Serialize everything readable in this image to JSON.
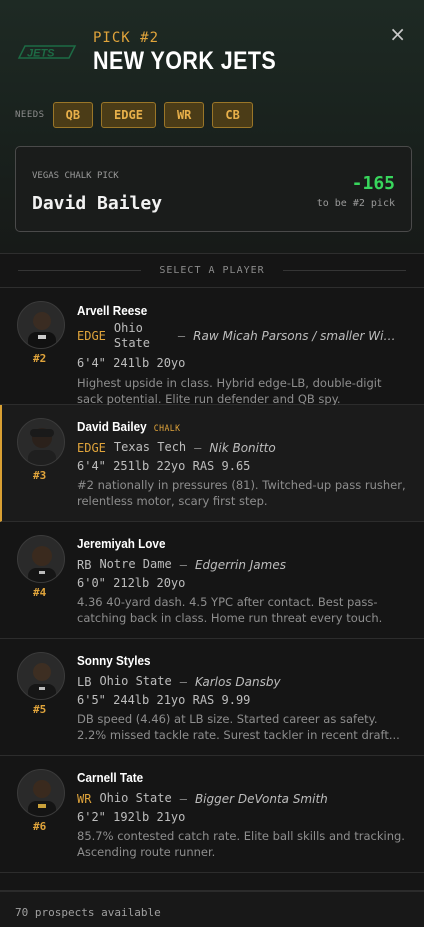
{
  "header": {
    "logo_text": "JETS",
    "pick_label": "PICK #2",
    "team_name": "NEW YORK JETS",
    "close_glyph": "×"
  },
  "needs": {
    "label": "NEEDS",
    "positions": [
      "QB",
      "EDGE",
      "WR",
      "CB"
    ]
  },
  "chalk": {
    "label": "VEGAS CHALK PICK",
    "player": "David Bailey",
    "odds": "-165",
    "sub": "to be #2 pick"
  },
  "select_label": "SELECT A PLAYER",
  "players": [
    {
      "name": "Arvell Reese",
      "tag": "",
      "position": "EDGE",
      "school": "Ohio State",
      "comp": "Raw Micah Parsons / smaller Willi...",
      "measures": "6'4\" 241lb 20yo",
      "blurb": "Highest upside in class. Hybrid edge-LB, double-digit sack potential. Elite run defender and QB spy.",
      "pick": "#2"
    },
    {
      "name": "David Bailey",
      "tag": "CHALK",
      "position": "EDGE",
      "school": "Texas Tech",
      "comp": "Nik Bonitto",
      "measures": "6'4\" 251lb 22yo RAS 9.65",
      "blurb": "#2 nationally in pressures (81). Twitched-up pass rusher, relentless motor, scary first step.",
      "pick": "#3"
    },
    {
      "name": "Jeremiyah Love",
      "tag": "",
      "position": "RB",
      "school": "Notre Dame",
      "comp": "Edgerrin James",
      "measures": "6'0\" 212lb 20yo",
      "blurb": "4.36 40-yard dash. 4.5 YPC after contact. Best pass-catching back in class. Home run threat every touch.",
      "pick": "#4"
    },
    {
      "name": "Sonny Styles",
      "tag": "",
      "position": "LB",
      "school": "Ohio State",
      "comp": "Karlos Dansby",
      "measures": "6'5\" 244lb 21yo RAS 9.99",
      "blurb": "DB speed (4.46) at LB size. Started career as safety. 2.2% missed tackle rate. Surest tackler in recent draft...",
      "pick": "#5"
    },
    {
      "name": "Carnell Tate",
      "tag": "",
      "position": "WR",
      "school": "Ohio State",
      "comp": "Bigger DeVonta Smith",
      "measures": "6'2\" 192lb 21yo",
      "blurb": "85.7% contested catch rate. Elite ball skills and tracking. Ascending route runner.",
      "pick": "#6"
    }
  ],
  "footer": {
    "text": "70 prospects available"
  },
  "colors": {
    "accent": "#e0a43b",
    "odds_green": "#38d65c",
    "jets_green": "#1d6b45"
  }
}
